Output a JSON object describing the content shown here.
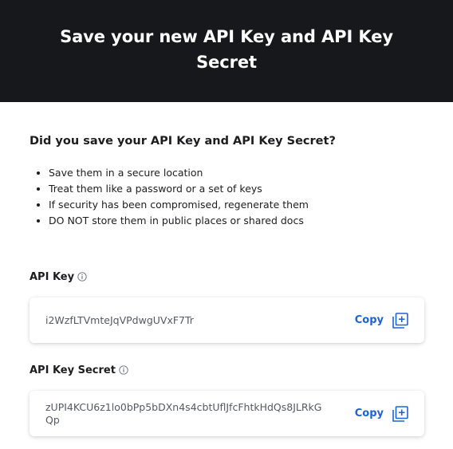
{
  "header": {
    "title": "Save your new API Key and API Key Secret"
  },
  "question": "Did you save your API Key and API Key Secret?",
  "tips": [
    "Save them in a secure location",
    "Treat them like a password or a set of keys",
    "If security has been compromised, regenerate them",
    "DO NOT store them in public places or shared docs"
  ],
  "api_key": {
    "label": "API Key",
    "value": "i2WzfLTVmteJqVPdwgUVxF7Tr",
    "copy_label": "Copy"
  },
  "api_key_secret": {
    "label": "API Key Secret",
    "value": "zUPI4KCU6z1lo0bPp5bDXn4s4cbtUflJfcFhtkHdQs8JLRkGQp",
    "copy_label": "Copy"
  },
  "icons": {
    "info": "info-circle-icon",
    "copy": "copy-plus-icon"
  },
  "colors": {
    "header_bg": "#16181b",
    "accent": "#1d63d6"
  }
}
